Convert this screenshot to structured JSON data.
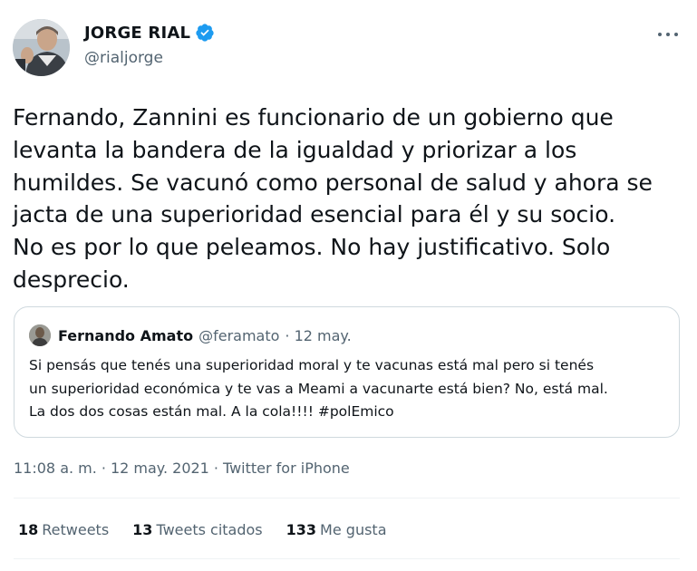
{
  "author": {
    "display_name": "JORGE RIAL",
    "handle": "@rialjorge",
    "verified": true
  },
  "tweet": {
    "lines": [
      "Fernando, Zannini es funcionario de un gobierno que",
      "levanta la bandera de la igualdad y priorizar a los",
      "humildes. Se vacunó como personal de salud y ahora se",
      "jacta de una superioridad esencial para él y su socio.",
      "No es por lo que peleamos. No hay justificativo. Solo",
      "desprecio."
    ]
  },
  "quoted": {
    "display_name": "Fernando Amato",
    "handle": "@feramato",
    "date": "· 12 may.",
    "lines": [
      "Si pensás que tenés una superioridad moral y te vacunas está mal pero si tenés",
      "un superioridad económica y te vas a Meami a vacunarte está bien? No, está mal.",
      "La dos dos cosas están mal. A la cola!!!! #polEmico"
    ]
  },
  "meta": {
    "time": "11:08 a. m.",
    "date": "12 may. 2021",
    "separator": "·",
    "source": "Twitter for iPhone"
  },
  "stats": {
    "retweets": {
      "count": "18",
      "label": "Retweets"
    },
    "quotes": {
      "count": "13",
      "label": "Tweets citados"
    },
    "likes": {
      "count": "133",
      "label": "Me gusta"
    }
  },
  "colors": {
    "verified": "#1d9bf0",
    "secondary_text": "#536471",
    "border": "#cfd9de"
  },
  "icons": {
    "verified": "verified-badge-icon",
    "more": "more-options-icon"
  }
}
